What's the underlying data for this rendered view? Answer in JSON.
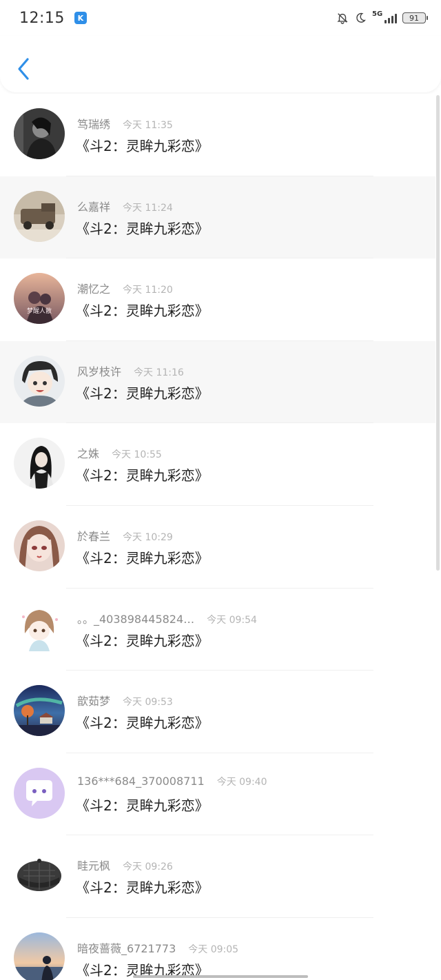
{
  "status_bar": {
    "time": "12:15",
    "app_icon": "K",
    "network": "5G",
    "battery": "91",
    "icons": [
      "bell-off-icon",
      "moon-icon",
      "signal-icon",
      "battery-icon"
    ]
  },
  "header": {
    "back_icon": "chevron-left-icon",
    "accent_color": "#2f8fe8"
  },
  "items": [
    {
      "name": "笃瑞绣",
      "time": "今天 11:35",
      "content": "《斗2：灵眸九彩恋》",
      "avatar": "dark-portrait-avatar"
    },
    {
      "name": "么嘉祥",
      "time": "今天 11:24",
      "content": "《斗2：灵眸九彩恋》",
      "avatar": "vintage-car-avatar"
    },
    {
      "name": "潮忆之",
      "time": "今天 11:20",
      "content": "《斗2：灵眸九彩恋》",
      "avatar": "sunset-couple-avatar",
      "avatar_text": "梦醒人散"
    },
    {
      "name": "风岁枝许",
      "time": "今天 11:16",
      "content": "《斗2：灵眸九彩恋》",
      "avatar": "anime-boy-avatar"
    },
    {
      "name": "之姝",
      "time": "今天 10:55",
      "content": "《斗2：灵眸九彩恋》",
      "avatar": "girl-scarf-avatar"
    },
    {
      "name": "於春兰",
      "time": "今天 10:29",
      "content": "《斗2：灵眸九彩恋》",
      "avatar": "anime-girl-avatar"
    },
    {
      "name": "。。_403898445824…",
      "time": "今天 09:54",
      "content": "《斗2：灵眸九彩恋》",
      "avatar": "cute-girl-avatar"
    },
    {
      "name": "歆茹梦",
      "time": "今天 09:53",
      "content": "《斗2：灵眸九彩恋》",
      "avatar": "aurora-night-avatar"
    },
    {
      "name": "136***684_370008711",
      "time": "今天 09:40",
      "content": "《斗2：灵眸九彩恋》",
      "avatar": "default-chat-avatar"
    },
    {
      "name": "畦元枫",
      "time": "今天 09:26",
      "content": "《斗2：灵眸九彩恋》",
      "avatar": "beret-hat-avatar"
    },
    {
      "name": "暗夜蔷薇_6721773",
      "time": "今天 09:05",
      "content": "《斗2：灵眸九彩恋》",
      "avatar": "sea-sunset-avatar"
    }
  ]
}
